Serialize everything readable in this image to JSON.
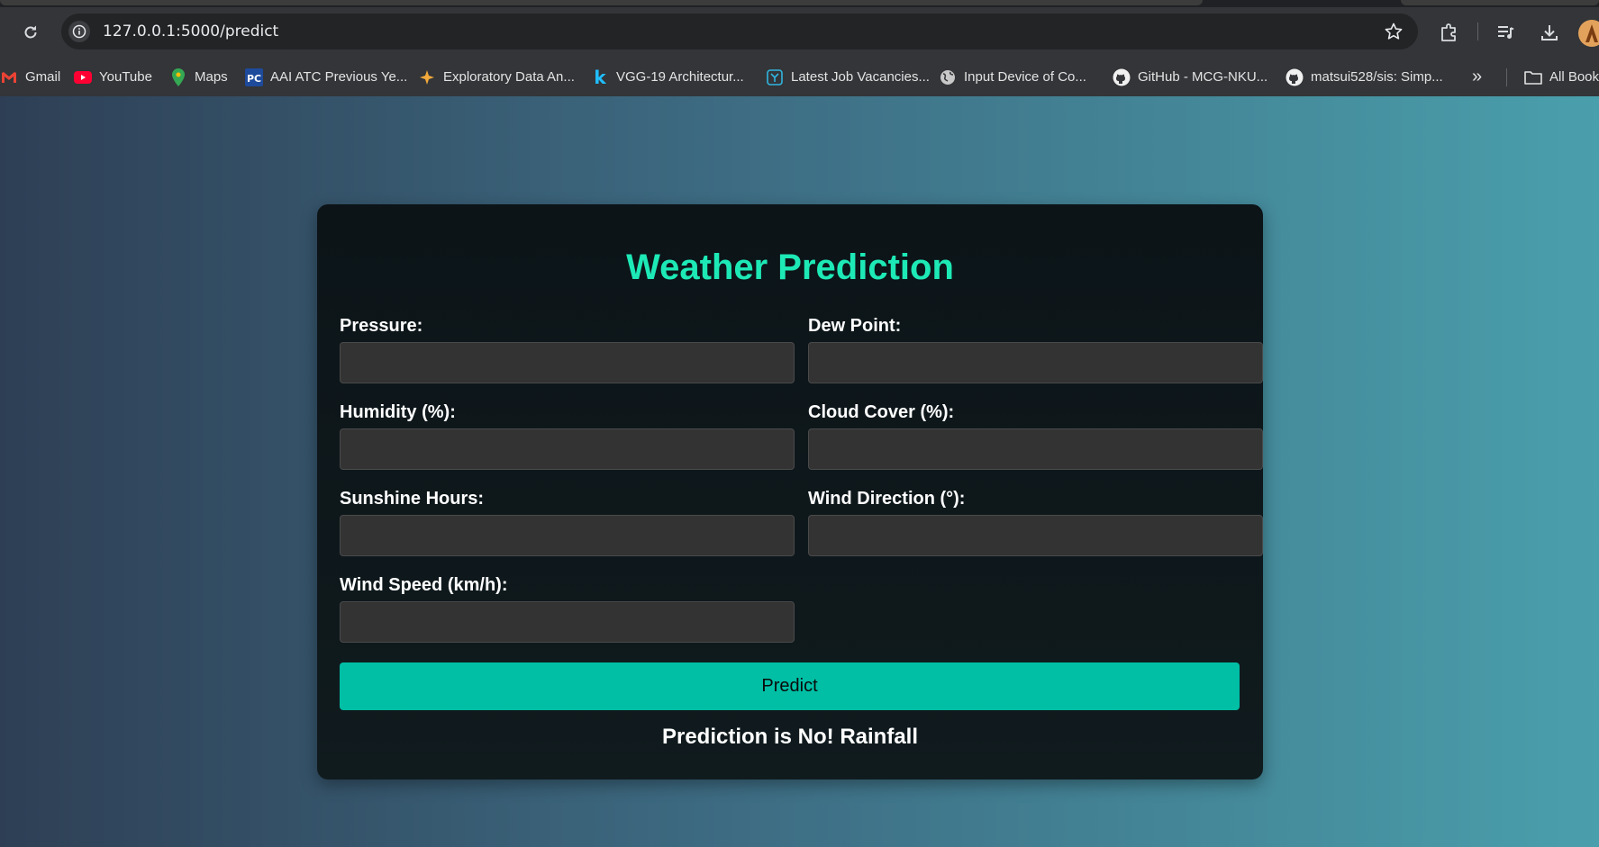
{
  "browser": {
    "url": "127.0.0.1:5000/predict",
    "bookmarks": [
      {
        "label": "Gmail",
        "icon": "gmail-icon"
      },
      {
        "label": "YouTube",
        "icon": "youtube-icon"
      },
      {
        "label": "Maps",
        "icon": "maps-icon"
      },
      {
        "label": "AAI ATC Previous Ye...",
        "icon": "pc-icon"
      },
      {
        "label": "Exploratory Data An...",
        "icon": "sparkle-icon"
      },
      {
        "label": "VGG-19 Architectur...",
        "icon": "kaggle-icon"
      },
      {
        "label": "Latest Job Vacancies...",
        "icon": "job-icon"
      },
      {
        "label": "Input Device of Co...",
        "icon": "globe-icon"
      },
      {
        "label": "GitHub - MCG-NKU...",
        "icon": "github-icon"
      },
      {
        "label": "matsui528/sis: Simp...",
        "icon": "github-icon"
      }
    ],
    "more_bookmarks": "»",
    "all_bookmarks": "All Bookmarks"
  },
  "form": {
    "title": "Weather Prediction",
    "fields": [
      {
        "label": "Pressure:",
        "value": ""
      },
      {
        "label": "Dew Point:",
        "value": ""
      },
      {
        "label": "Humidity (%):",
        "value": ""
      },
      {
        "label": "Cloud Cover (%):",
        "value": ""
      },
      {
        "label": "Sunshine Hours:",
        "value": ""
      },
      {
        "label": "Wind Direction (°):",
        "value": ""
      },
      {
        "label": "Wind Speed (km/h):",
        "value": ""
      }
    ],
    "submit_label": "Predict",
    "result": "Prediction is No! Rainfall"
  },
  "colors": {
    "accent": "#1de9b6",
    "button": "#00bfa5",
    "card": "#0c1418",
    "input": "#333333"
  }
}
